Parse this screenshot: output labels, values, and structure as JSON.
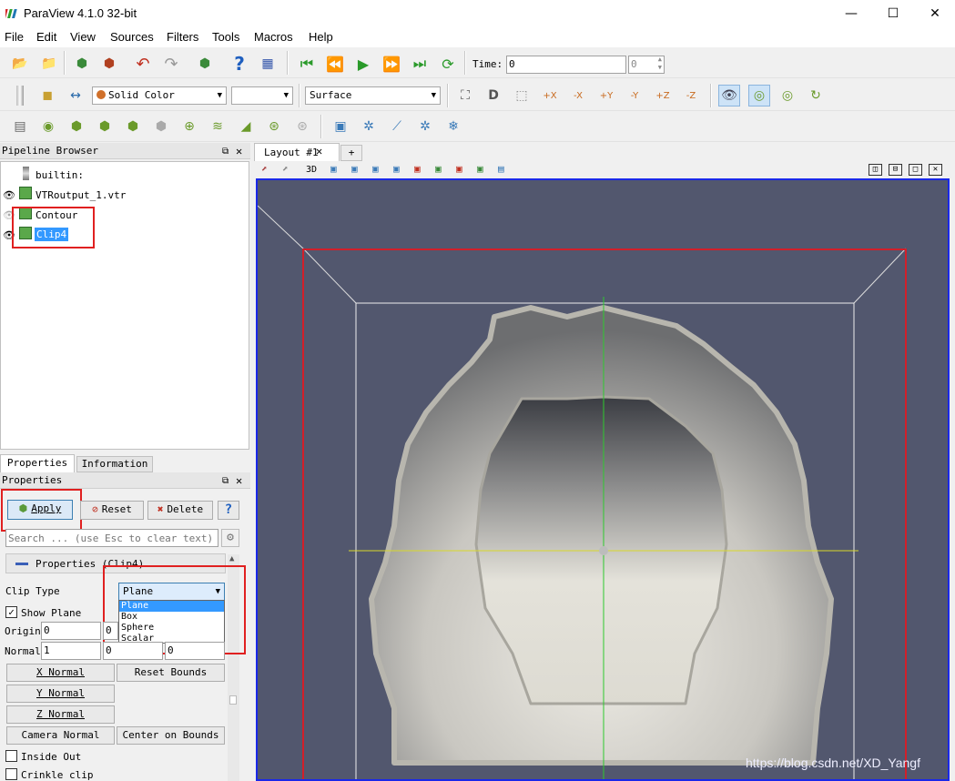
{
  "window": {
    "title": "ParaView 4.1.0 32-bit",
    "minimize": "—",
    "maximize": "☐",
    "close": "✕"
  },
  "menu": [
    "File",
    "Edit",
    "View",
    "Sources",
    "Filters",
    "Tools",
    "Macros",
    "Help"
  ],
  "time": {
    "label": "Time:",
    "value": "0",
    "index": "0"
  },
  "coloring": {
    "value": "Solid Color",
    "component": ""
  },
  "representation": {
    "value": "Surface"
  },
  "pipeline": {
    "title": "Pipeline Browser",
    "items": [
      "builtin:",
      "VTRoutput_1.vtr",
      "Contour",
      "Clip4"
    ]
  },
  "layout_tabs": {
    "active": "Layout #1",
    "add": "+",
    "view_mode": "3D"
  },
  "panel_tabs": {
    "properties": "Properties",
    "information": "Information"
  },
  "properties": {
    "title": "Properties",
    "apply": "Apply",
    "reset": "Reset",
    "delete": "Delete",
    "help": "?",
    "search_placeholder": "Search ... (use Esc to clear text)",
    "section": "Properties (Clip4)",
    "clip_type_label": "Clip Type",
    "clip_type_value": "Plane",
    "clip_options": [
      "Plane",
      "Box",
      "Sphere",
      "Scalar"
    ],
    "show_plane": "Show Plane",
    "origin_label": "Origin",
    "origin": [
      "0",
      "0",
      "0"
    ],
    "normal_label": "Normal",
    "normal": [
      "1",
      "0",
      "0"
    ],
    "x_normal": "X Normal",
    "y_normal": "Y Normal",
    "z_normal": "Z Normal",
    "reset_bounds": "Reset Bounds",
    "camera_normal": "Camera Normal",
    "center_on_bounds": "Center on Bounds",
    "inside_out": "Inside Out",
    "crinkle_clip": "Crinkle clip"
  },
  "watermark": "https://blog.csdn.net/XD_Yangf",
  "colors": {
    "view_bg": "#52576e",
    "active_border": "#1a28e8",
    "highlight": "#e02020",
    "selection": "#3399ff"
  }
}
